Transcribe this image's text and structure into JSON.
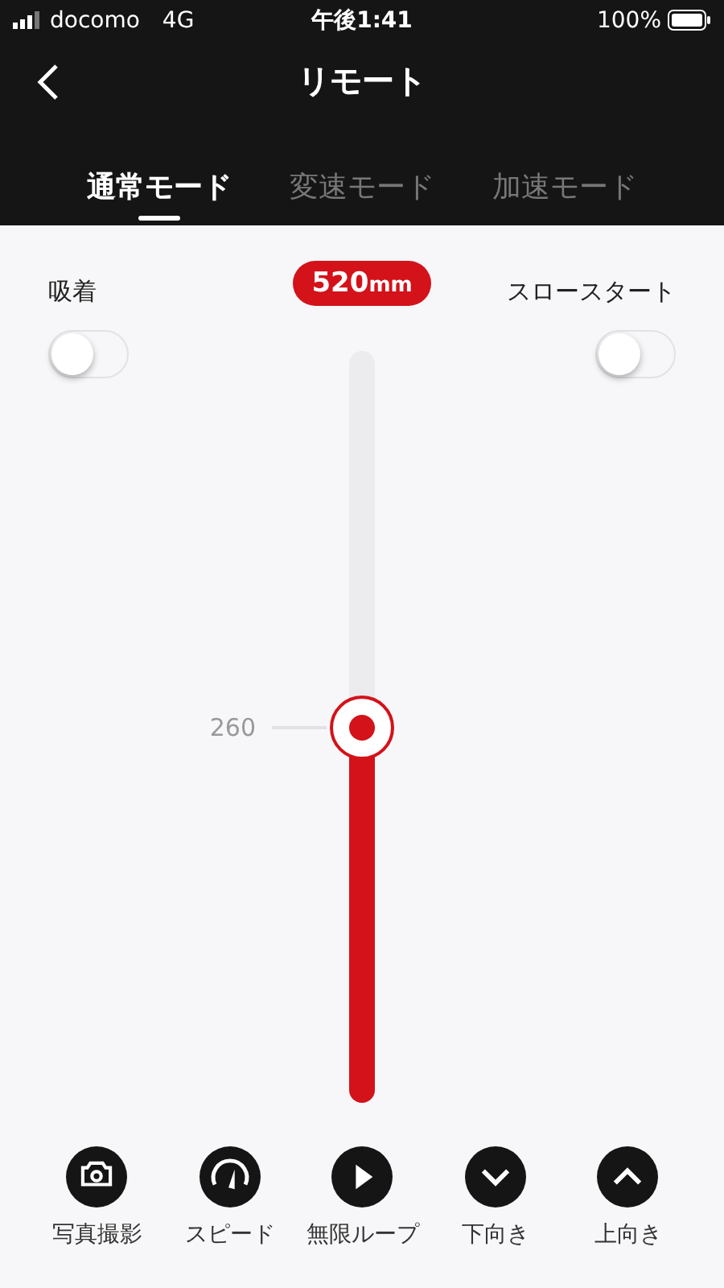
{
  "status_bar": {
    "carrier": "docomo",
    "network": "4G",
    "time": "午後1:41",
    "battery": "100%"
  },
  "nav": {
    "title": "リモート"
  },
  "tabs": [
    {
      "label": "通常モード",
      "selected": true
    },
    {
      "label": "変速モード",
      "selected": false
    },
    {
      "label": "加速モード",
      "selected": false
    }
  ],
  "toggles": [
    {
      "label": "吸着",
      "on": false
    },
    {
      "label": "スロースタート",
      "on": false
    }
  ],
  "slider": {
    "value": "520",
    "unit": "mm",
    "level": 0.5,
    "mark": "260"
  },
  "toolbar": [
    {
      "kind": "camera",
      "label": "写真撮影"
    },
    {
      "kind": "gauge",
      "label": "スピード"
    },
    {
      "kind": "play",
      "label": "無限ループ"
    },
    {
      "kind": "down",
      "label": "下向き"
    },
    {
      "kind": "up",
      "label": "上向き"
    }
  ]
}
